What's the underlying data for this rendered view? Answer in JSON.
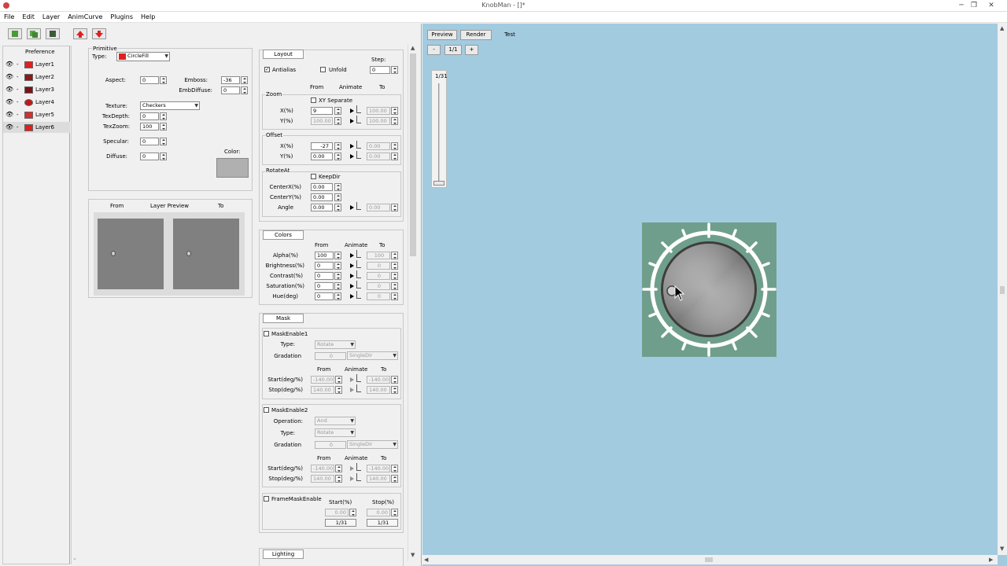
{
  "window": {
    "title": "KnobMan - []*",
    "minimize": "─",
    "restore": "❐",
    "close": "✕"
  },
  "menu": [
    "File",
    "Edit",
    "Layer",
    "AnimCurve",
    "Plugins",
    "Help"
  ],
  "layers": {
    "header": "Preference",
    "items": [
      {
        "name": "Layer1",
        "color": "#e0201e"
      },
      {
        "name": "Layer2",
        "color": "#8a1a1a"
      },
      {
        "name": "Layer3",
        "color": "#7a1515"
      },
      {
        "name": "Layer4",
        "color": "#c01818"
      },
      {
        "name": "Layer5",
        "color": "#d43030"
      },
      {
        "name": "Layer6",
        "color": "#e0201e"
      }
    ],
    "eye": "👁",
    "dash": "-"
  },
  "primitive": {
    "group_label": "Primitive",
    "type_label": "Type:",
    "type_value": "CircleFill",
    "aspect_label": "Aspect:",
    "aspect": "0",
    "emboss_label": "Emboss:",
    "emboss": "-36",
    "embdiffuse_label": "EmbDiffuse:",
    "embdiffuse": "0",
    "texture_label": "Texture:",
    "texture": "Checkers",
    "texdepth_label": "TexDepth:",
    "texdepth": "0",
    "texzoom_label": "TexZoom:",
    "texzoom": "100",
    "specular_label": "Specular:",
    "specular": "0",
    "diffuse_label": "Diffuse:",
    "diffuse": "0",
    "color_label": "Color:",
    "color": "#b0b0b0"
  },
  "preview": {
    "from": "From",
    "title": "Layer Preview",
    "to": "To"
  },
  "layout": {
    "tab": "Layout",
    "antialias": "Antialias",
    "unfold": "Unfold",
    "step_label": "Step:",
    "step": "0",
    "from": "From",
    "animate": "Animate",
    "to": "To",
    "zoom": "Zoom",
    "xy_separate": "XY Separate",
    "x_label": "X(%)",
    "x_from": "9",
    "x_to": "100.00",
    "y_label": "Y(%)",
    "y_from": "100.00",
    "y_to": "100.00",
    "offset": "Offset",
    "ox_label": "X(%)",
    "ox_from": "-27",
    "ox_to": "0.00",
    "oy_label": "Y(%)",
    "oy_from": "0.00",
    "oy_to": "0.00",
    "rotateat": "RotateAt",
    "keepdir": "KeepDir",
    "cx_label": "CenterX(%)",
    "cx": "0.00",
    "cy_label": "CenterY(%)",
    "cy": "0.00",
    "angle_label": "Angle",
    "angle_from": "0.00",
    "angle_to": "0.00"
  },
  "colors": {
    "tab": "Colors",
    "from": "From",
    "animate": "Animate",
    "to": "To",
    "rows": [
      {
        "label": "Alpha(%)",
        "from": "100",
        "to": "100"
      },
      {
        "label": "Brightness(%)",
        "from": "0",
        "to": "0"
      },
      {
        "label": "Contrast(%)",
        "from": "0",
        "to": "0"
      },
      {
        "label": "Saturation(%)",
        "from": "0",
        "to": "0"
      },
      {
        "label": "Hue(deg)",
        "from": "0",
        "to": "0"
      }
    ]
  },
  "mask": {
    "tab": "Mask",
    "m1": "MaskEnable1",
    "type_label": "Type:",
    "type_value": "Rotate",
    "gradation_label": "Gradation",
    "gradation": "0",
    "singledir": "SingleDir",
    "from": "From",
    "animate": "Animate",
    "to": "To",
    "start_label": "Start(deg/%)",
    "start_from": "-140.00",
    "start_to": "-140.00",
    "stop_label": "Stop(deg/%)",
    "stop_from": "140.00",
    "stop_to": "140.00",
    "m2": "MaskEnable2",
    "operation_label": "Operation:",
    "operation": "And",
    "type2_value": "Rotate",
    "gradation2": "0",
    "start2_from": "-140.00",
    "start2_to": "-140.00",
    "stop2_from": "140.00",
    "stop2_to": "140.00",
    "framemask": "FrameMaskEnable",
    "fm_start_label": "Start(%)",
    "fm_stop_label": "Stop(%)",
    "fm_start": "0.00",
    "fm_stop": "0.00",
    "fm_start_frame": "1/31",
    "fm_stop_frame": "1/31"
  },
  "lighting": {
    "tab": "Lighting"
  },
  "right": {
    "tabs": [
      "Preview",
      "Render",
      "Test"
    ],
    "minus": "-",
    "frame": "1/1",
    "plus": "+",
    "slider_label": "1/31",
    "slider_value": 0
  }
}
